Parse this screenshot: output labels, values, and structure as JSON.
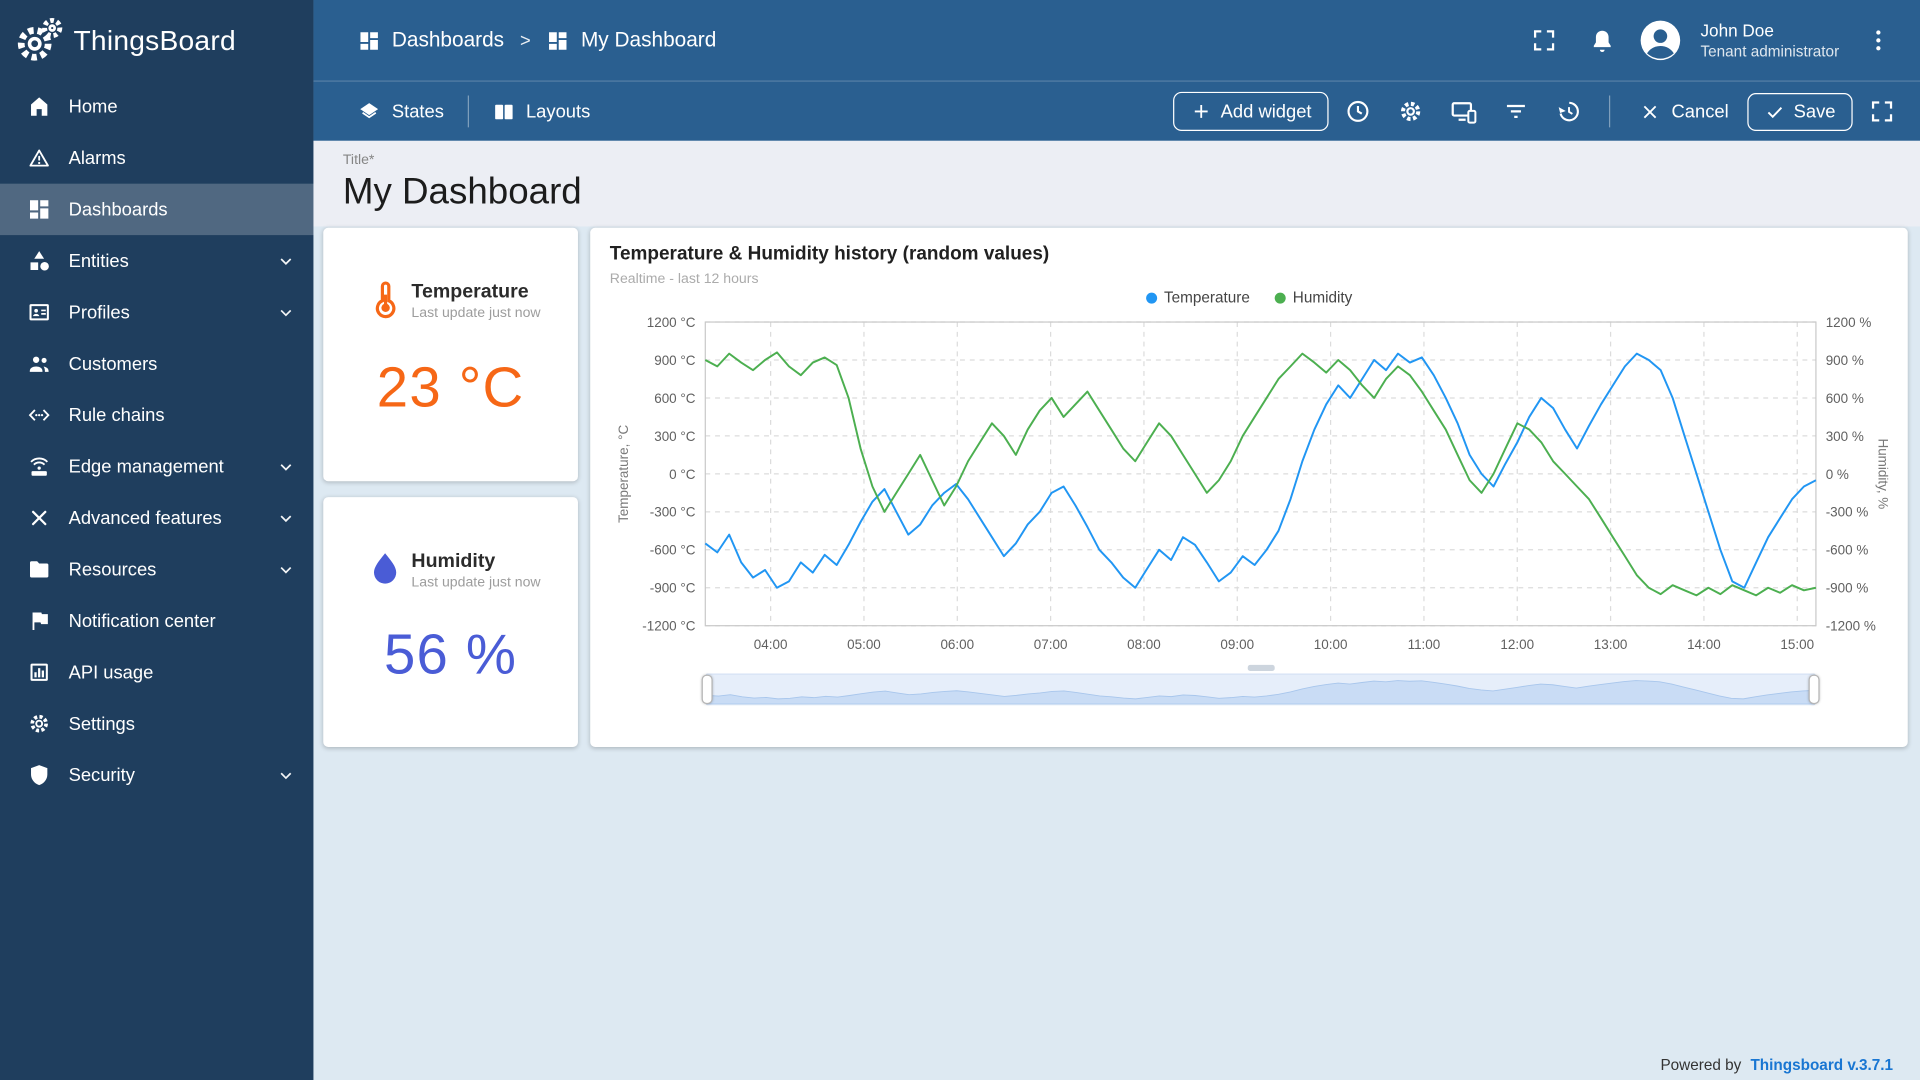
{
  "app": {
    "name": "ThingsBoard",
    "footer": {
      "powered_by": "Powered by",
      "version": "Thingsboard v.3.7.1"
    }
  },
  "header": {
    "breadcrumb": {
      "root": "Dashboards",
      "separator": ">",
      "current": "My Dashboard"
    },
    "user": {
      "name": "John Doe",
      "role": "Tenant administrator"
    }
  },
  "sidebar": {
    "items": [
      {
        "label": "Home",
        "icon": "home-icon"
      },
      {
        "label": "Alarms",
        "icon": "alarm-icon"
      },
      {
        "label": "Dashboards",
        "icon": "dashboards-icon",
        "active": true
      },
      {
        "label": "Entities",
        "icon": "entities-icon",
        "expandable": true
      },
      {
        "label": "Profiles",
        "icon": "profiles-icon",
        "expandable": true
      },
      {
        "label": "Customers",
        "icon": "customers-icon"
      },
      {
        "label": "Rule chains",
        "icon": "rule-chains-icon"
      },
      {
        "label": "Edge management",
        "icon": "edge-icon",
        "expandable": true
      },
      {
        "label": "Advanced features",
        "icon": "advanced-icon",
        "expandable": true
      },
      {
        "label": "Resources",
        "icon": "resources-icon",
        "expandable": true
      },
      {
        "label": "Notification center",
        "icon": "notification-icon"
      },
      {
        "label": "API usage",
        "icon": "api-icon"
      },
      {
        "label": "Settings",
        "icon": "settings-icon"
      },
      {
        "label": "Security",
        "icon": "security-icon",
        "expandable": true
      }
    ]
  },
  "toolbar": {
    "states": "States",
    "layouts": "Layouts",
    "add_widget": "Add widget",
    "cancel": "Cancel",
    "save": "Save"
  },
  "title_section": {
    "label": "Title*",
    "value": "My Dashboard"
  },
  "widgets": {
    "temperature": {
      "title": "Temperature",
      "subtitle": "Last update just now",
      "value": "23 °C",
      "accent": "#f66716"
    },
    "humidity": {
      "title": "Humidity",
      "subtitle": "Last update just now",
      "value": "56 %",
      "accent": "#4a5cd6"
    }
  },
  "chart_data": {
    "type": "line",
    "title": "Temperature & Humidity history (random values)",
    "subtitle": "Realtime - last 12 hours",
    "legend_position": "top-center",
    "grid": "dashed",
    "ylim": [
      -1200,
      1200
    ],
    "y_tick_step": 300,
    "y_left_unit": "°C",
    "y_right_unit": "%",
    "ylabel_left": "Temperature, °C",
    "ylabel_right": "Humidity, %",
    "x_domain": [
      3.3,
      15.2
    ],
    "x_ticks": [
      {
        "h": 4,
        "label": "04:00"
      },
      {
        "h": 5,
        "label": "05:00"
      },
      {
        "h": 6,
        "label": "06:00"
      },
      {
        "h": 7,
        "label": "07:00"
      },
      {
        "h": 8,
        "label": "08:00"
      },
      {
        "h": 9,
        "label": "09:00"
      },
      {
        "h": 10,
        "label": "10:00"
      },
      {
        "h": 11,
        "label": "11:00"
      },
      {
        "h": 12,
        "label": "12:00"
      },
      {
        "h": 13,
        "label": "13:00"
      },
      {
        "h": 14,
        "label": "14:00"
      },
      {
        "h": 15,
        "label": "15:00"
      }
    ],
    "series": [
      {
        "name": "Temperature",
        "color": "#2196f3",
        "values": [
          -550,
          -620,
          -480,
          -700,
          -820,
          -760,
          -900,
          -850,
          -700,
          -780,
          -640,
          -720,
          -560,
          -380,
          -220,
          -120,
          -300,
          -480,
          -400,
          -250,
          -150,
          -80,
          -200,
          -350,
          -500,
          -650,
          -550,
          -400,
          -300,
          -150,
          -100,
          -250,
          -420,
          -600,
          -700,
          -820,
          -900,
          -750,
          -600,
          -680,
          -500,
          -560,
          -700,
          -850,
          -780,
          -650,
          -720,
          -600,
          -450,
          -200,
          100,
          350,
          550,
          700,
          600,
          750,
          900,
          820,
          950,
          880,
          920,
          780,
          600,
          400,
          150,
          0,
          -100,
          80,
          250,
          450,
          600,
          520,
          350,
          200,
          380,
          550,
          700,
          850,
          950,
          900,
          820,
          600,
          300,
          0,
          -300,
          -600,
          -850,
          -900,
          -700,
          -500,
          -350,
          -200,
          -100,
          -50
        ]
      },
      {
        "name": "Humidity",
        "color": "#4caf50",
        "values": [
          900,
          850,
          950,
          880,
          820,
          900,
          960,
          850,
          780,
          880,
          920,
          860,
          600,
          200,
          -100,
          -300,
          -150,
          0,
          150,
          -50,
          -250,
          -100,
          100,
          250,
          400,
          300,
          150,
          350,
          500,
          600,
          450,
          550,
          650,
          500,
          350,
          200,
          100,
          250,
          400,
          300,
          150,
          0,
          -150,
          -50,
          100,
          300,
          450,
          600,
          750,
          850,
          950,
          880,
          800,
          900,
          820,
          700,
          600,
          750,
          850,
          780,
          650,
          500,
          350,
          150,
          -50,
          -150,
          0,
          200,
          400,
          350,
          250,
          100,
          0,
          -100,
          -200,
          -350,
          -500,
          -650,
          -800,
          -900,
          -950,
          -880,
          -920,
          -960,
          -900,
          -950,
          -880,
          -920,
          -960,
          -900,
          -940,
          -880,
          -920,
          -900
        ]
      }
    ]
  }
}
